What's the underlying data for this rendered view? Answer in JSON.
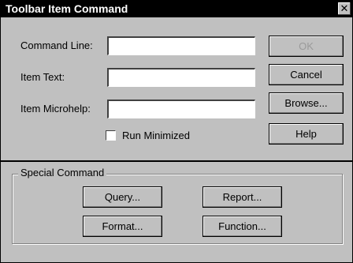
{
  "dialog": {
    "title": "Toolbar Item Command",
    "close_glyph": "✕"
  },
  "fields": {
    "command_line": {
      "label": "Command Line:",
      "value": ""
    },
    "item_text": {
      "label": "Item Text:",
      "value": ""
    },
    "item_microhelp": {
      "label": "Item Microhelp:",
      "value": ""
    }
  },
  "checkbox": {
    "label": "Run Minimized",
    "checked": false
  },
  "buttons": {
    "ok": "OK",
    "cancel": "Cancel",
    "browse": "Browse...",
    "help": "Help"
  },
  "special_command": {
    "title": "Special Command",
    "query": "Query...",
    "report": "Report...",
    "format": "Format...",
    "function": "Function..."
  }
}
